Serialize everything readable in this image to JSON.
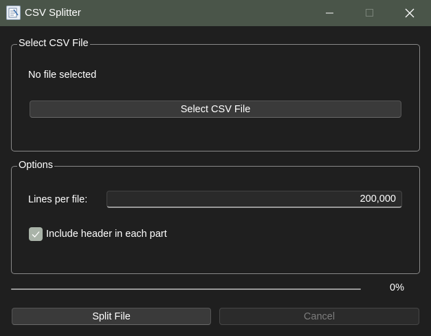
{
  "window": {
    "title": "CSV Splitter"
  },
  "file_group": {
    "title": "Select CSV File",
    "status": "No file selected",
    "select_button": "Select CSV File"
  },
  "options_group": {
    "title": "Options",
    "lines_label": "Lines per file:",
    "lines_value": "200,000",
    "include_header_label": "Include header in each part",
    "include_header_checked": true
  },
  "progress": {
    "value": 0,
    "text": "0%"
  },
  "actions": {
    "split_label": "Split File",
    "cancel_label": "Cancel",
    "cancel_enabled": false
  },
  "colors": {
    "titlebar": "#4a5549",
    "background": "#1f1f1f",
    "checkbox": "#a9b3a8"
  },
  "icons": {
    "app": "csv-splitter-app-icon",
    "minimize": "minimize-icon",
    "maximize": "maximize-icon",
    "close": "close-icon",
    "check": "checkmark-icon"
  }
}
